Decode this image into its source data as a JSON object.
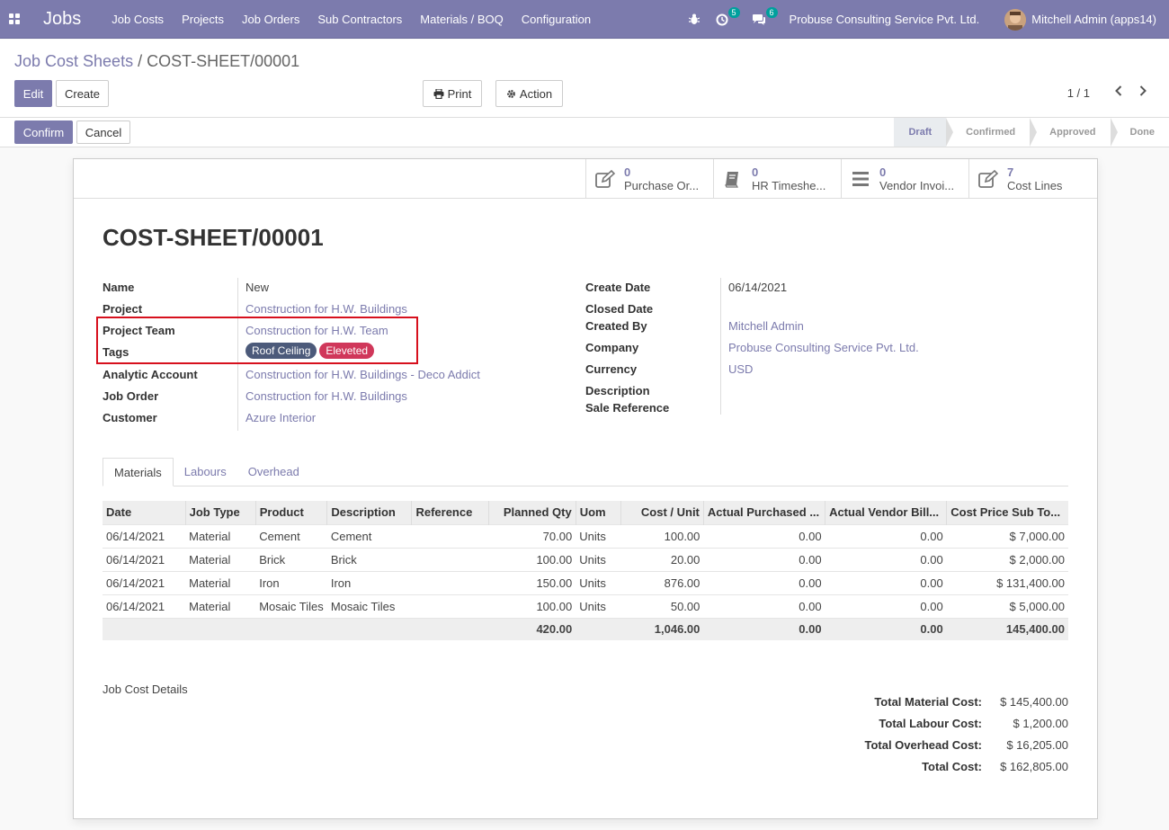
{
  "navbar": {
    "brand": "Jobs",
    "menu": [
      "Job Costs",
      "Projects",
      "Job Orders",
      "Sub Contractors",
      "Materials / BOQ",
      "Configuration"
    ],
    "activities_count": "5",
    "messages_count": "6",
    "company": "Probuse Consulting Service Pvt. Ltd.",
    "user": "Mitchell Admin (apps14)"
  },
  "breadcrumb": {
    "parent": "Job Cost Sheets",
    "separator": "/",
    "current": "COST-SHEET/00001"
  },
  "buttons": {
    "edit": "Edit",
    "create": "Create",
    "print": "Print",
    "action": "Action",
    "confirm": "Confirm",
    "cancel": "Cancel"
  },
  "pager": "1 / 1",
  "stages": [
    "Draft",
    "Confirmed",
    "Approved",
    "Done"
  ],
  "active_stage": "Draft",
  "smart_buttons": [
    {
      "count": "0",
      "label": "Purchase Or...",
      "icon": "edit-icon"
    },
    {
      "count": "0",
      "label": "HR Timeshe...",
      "icon": "book-icon"
    },
    {
      "count": "0",
      "label": "Vendor Invoi...",
      "icon": "list-icon"
    },
    {
      "count": "7",
      "label": "Cost Lines",
      "icon": "edit-icon"
    }
  ],
  "record": {
    "title": "COST-SHEET/00001",
    "left_fields": [
      {
        "label": "Name",
        "value": "New"
      },
      {
        "label": "Project",
        "value": "Construction for H.W. Buildings"
      },
      {
        "label": "Project Team",
        "value": "Construction for H.W. Team"
      },
      {
        "label": "Tags",
        "value": ""
      },
      {
        "label": "Analytic Account",
        "value": "Construction for H.W. Buildings - Deco Addict"
      },
      {
        "label": "Job Order",
        "value": "Construction for H.W. Buildings"
      },
      {
        "label": "Customer",
        "value": "Azure Interior"
      }
    ],
    "tags": [
      {
        "name": "Roof Ceiling",
        "color": "#4c5a7a"
      },
      {
        "name": "Eleveted",
        "color": "#d0375a"
      }
    ],
    "right_fields": [
      {
        "label": "Create Date",
        "value": "06/14/2021"
      },
      {
        "label": "Closed Date",
        "value": ""
      },
      {
        "label": "Created By",
        "value": "Mitchell Admin"
      },
      {
        "label": "Company",
        "value": "Probuse Consulting Service Pvt. Ltd."
      },
      {
        "label": "Currency",
        "value": "USD"
      },
      {
        "label": "Description",
        "value": ""
      },
      {
        "label": "Sale Reference",
        "value": ""
      }
    ]
  },
  "tabs": [
    "Materials",
    "Labours",
    "Overhead"
  ],
  "active_tab": "Materials",
  "table": {
    "columns": [
      "Date",
      "Job Type",
      "Product",
      "Description",
      "Reference",
      "Planned Qty",
      "Uom",
      "Cost / Unit",
      "Actual Purchased ...",
      "Actual Vendor Bill...",
      "Cost Price Sub To..."
    ],
    "rows": [
      [
        "06/14/2021",
        "Material",
        "Cement",
        "Cement",
        "",
        "70.00",
        "Units",
        "100.00",
        "0.00",
        "0.00",
        "$ 7,000.00"
      ],
      [
        "06/14/2021",
        "Material",
        "Brick",
        "Brick",
        "",
        "100.00",
        "Units",
        "20.00",
        "0.00",
        "0.00",
        "$ 2,000.00"
      ],
      [
        "06/14/2021",
        "Material",
        "Iron",
        "Iron",
        "",
        "150.00",
        "Units",
        "876.00",
        "0.00",
        "0.00",
        "$ 131,400.00"
      ],
      [
        "06/14/2021",
        "Material",
        "Mosaic Tiles",
        "Mosaic Tiles",
        "",
        "100.00",
        "Units",
        "50.00",
        "0.00",
        "0.00",
        "$ 5,000.00"
      ]
    ],
    "totals": [
      "",
      "",
      "",
      "",
      "",
      "420.00",
      "",
      "1,046.00",
      "0.00",
      "0.00",
      "145,400.00"
    ]
  },
  "details_label": "Job Cost Details",
  "summary": [
    {
      "label": "Total Material Cost:",
      "value": "$ 145,400.00"
    },
    {
      "label": "Total Labour Cost:",
      "value": "$ 1,200.00"
    },
    {
      "label": "Total Overhead Cost:",
      "value": "$ 16,205.00"
    },
    {
      "label": "Total Cost:",
      "value": "$ 162,805.00"
    }
  ]
}
